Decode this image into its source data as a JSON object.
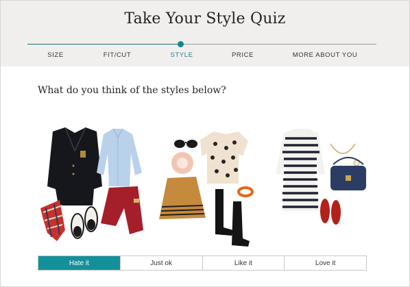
{
  "header": {
    "title": "Take Your Style Quiz",
    "steps": [
      {
        "label": "SIZE",
        "active": false
      },
      {
        "label": "FIT/CUT",
        "active": false
      },
      {
        "label": "STYLE",
        "active": true
      },
      {
        "label": "PRICE",
        "active": false
      },
      {
        "label": "MORE ABOUT YOU",
        "active": false
      }
    ]
  },
  "main": {
    "question": "What do you think of the styles below?",
    "answers": [
      {
        "label": "Hate it",
        "selected": true
      },
      {
        "label": "Just ok",
        "selected": false
      },
      {
        "label": "Like it",
        "selected": false
      },
      {
        "label": "Love it",
        "selected": false
      }
    ]
  },
  "colors": {
    "accent": "#14909a",
    "header_bg": "#f1efed"
  }
}
